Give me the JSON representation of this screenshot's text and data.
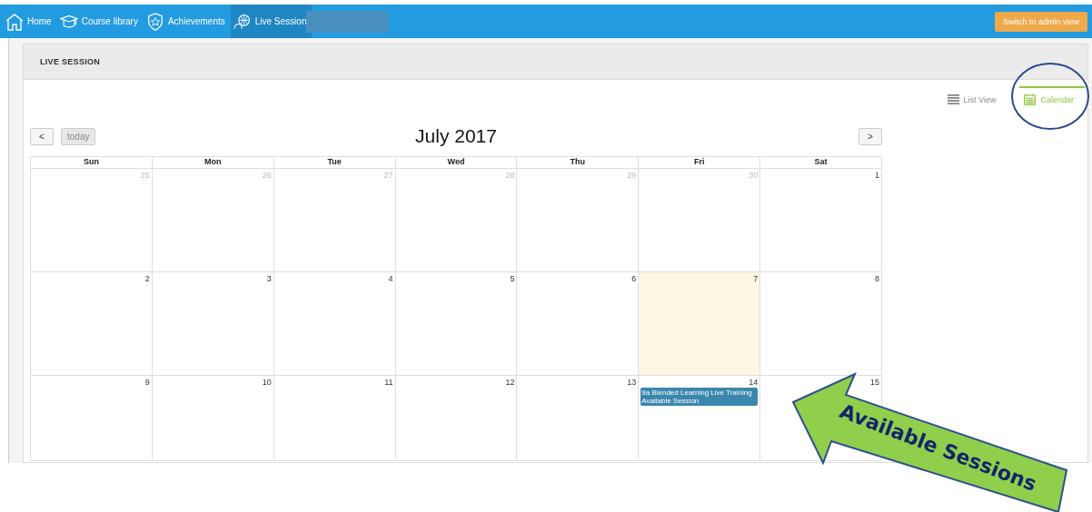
{
  "nav": {
    "items": [
      {
        "label": "Home",
        "kind": "home",
        "selected": false
      },
      {
        "label": "Course library",
        "kind": "cap",
        "selected": false
      },
      {
        "label": "Achievements",
        "kind": "shield",
        "selected": false
      },
      {
        "label": "Live Session",
        "kind": "globe",
        "selected": true
      }
    ],
    "admin_button": "Switch to admin view"
  },
  "panel": {
    "title": "LIVE SESSION",
    "views": [
      {
        "label": "List View",
        "kind": "list",
        "selected": false
      },
      {
        "label": "Calendar",
        "kind": "calendar",
        "selected": true
      }
    ]
  },
  "calendar": {
    "title": "July 2017",
    "today_button": "today",
    "prev": "<",
    "next": ">",
    "weekdays": [
      "Sun",
      "Mon",
      "Tue",
      "Wed",
      "Thu",
      "Fri",
      "Sat"
    ],
    "weeks": [
      [
        {
          "day": "25",
          "other_month": true,
          "today": false
        },
        {
          "day": "26",
          "other_month": true,
          "today": false
        },
        {
          "day": "27",
          "other_month": true,
          "today": false
        },
        {
          "day": "28",
          "other_month": true,
          "today": false
        },
        {
          "day": "29",
          "other_month": true,
          "today": false
        },
        {
          "day": "30",
          "other_month": true,
          "today": false
        },
        {
          "day": "1",
          "other_month": false,
          "today": false
        }
      ],
      [
        {
          "day": "2",
          "other_month": false,
          "today": false
        },
        {
          "day": "3",
          "other_month": false,
          "today": false
        },
        {
          "day": "4",
          "other_month": false,
          "today": false
        },
        {
          "day": "5",
          "other_month": false,
          "today": false
        },
        {
          "day": "6",
          "other_month": false,
          "today": false
        },
        {
          "day": "7",
          "other_month": false,
          "today": true
        },
        {
          "day": "8",
          "other_month": false,
          "today": false
        }
      ],
      [
        {
          "day": "9",
          "other_month": false,
          "today": false
        },
        {
          "day": "10",
          "other_month": false,
          "today": false
        },
        {
          "day": "11",
          "other_month": false,
          "today": false
        },
        {
          "day": "12",
          "other_month": false,
          "today": false
        },
        {
          "day": "13",
          "other_month": false,
          "today": false
        },
        {
          "day": "14",
          "other_month": false,
          "today": false,
          "events": [
            {
              "title": "9a Blended Learning Live Training",
              "status": "Available Session"
            }
          ]
        },
        {
          "day": "15",
          "other_month": false,
          "today": false
        }
      ]
    ]
  },
  "callout": {
    "label": "Available Sessions"
  }
}
